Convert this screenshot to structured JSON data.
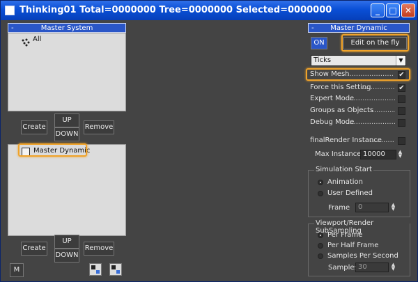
{
  "window": {
    "title": "Thinking01  Total=0000000  Tree=0000000  Selected=0000000"
  },
  "left": {
    "master_system": {
      "header": "Master System",
      "minus": "-",
      "item": "All"
    },
    "buttons1": {
      "create": "Create",
      "up": "UP",
      "down": "DOWN",
      "remove": "Remove"
    },
    "dynamic_list": {
      "item": "Master Dynamic"
    },
    "buttons2": {
      "create": "Create",
      "up": "UP",
      "down": "DOWN",
      "remove": "Remove"
    },
    "m_button": "M"
  },
  "right": {
    "header": "Master Dynamic",
    "minus": "-",
    "on_label": "ON",
    "edit_label": "Edit on the fly",
    "dropdown_value": "Ticks",
    "options": [
      {
        "label": "Show Mesh",
        "dots": "......................",
        "checked": true
      },
      {
        "label": "Force this Setting",
        "dots": "..................",
        "checked": true
      },
      {
        "label": "Expert Mode",
        "dots": "..........................",
        "checked": false
      },
      {
        "label": "Groups as Objects",
        "dots": "...................",
        "checked": false
      },
      {
        "label": "Debug Mode",
        "dots": "...........................",
        "checked": false
      }
    ],
    "final_render": {
      "label": "finalRender Instance",
      "dots": "............",
      "checked": false
    },
    "max_instances": {
      "label": "Max Instances",
      "value": "10000"
    },
    "sim_start": {
      "legend": "Simulation Start",
      "opt1": "Animation",
      "opt2": "User Defined",
      "frame_label": "Frame",
      "frame_value": "0",
      "selected": "Animation"
    },
    "subsampling": {
      "legend": "Viewport/Render SubSampling",
      "opt1": "Per Frame",
      "opt2": "Per Half Frame",
      "opt3": "Samples Per Second",
      "samples_label": "Samples",
      "samples_value": "30",
      "selected": "Per Frame"
    }
  },
  "check_glyph": "✔",
  "colors": {
    "accent": "#f0a32a",
    "header": "#2a56c7",
    "bg": "#444444"
  }
}
